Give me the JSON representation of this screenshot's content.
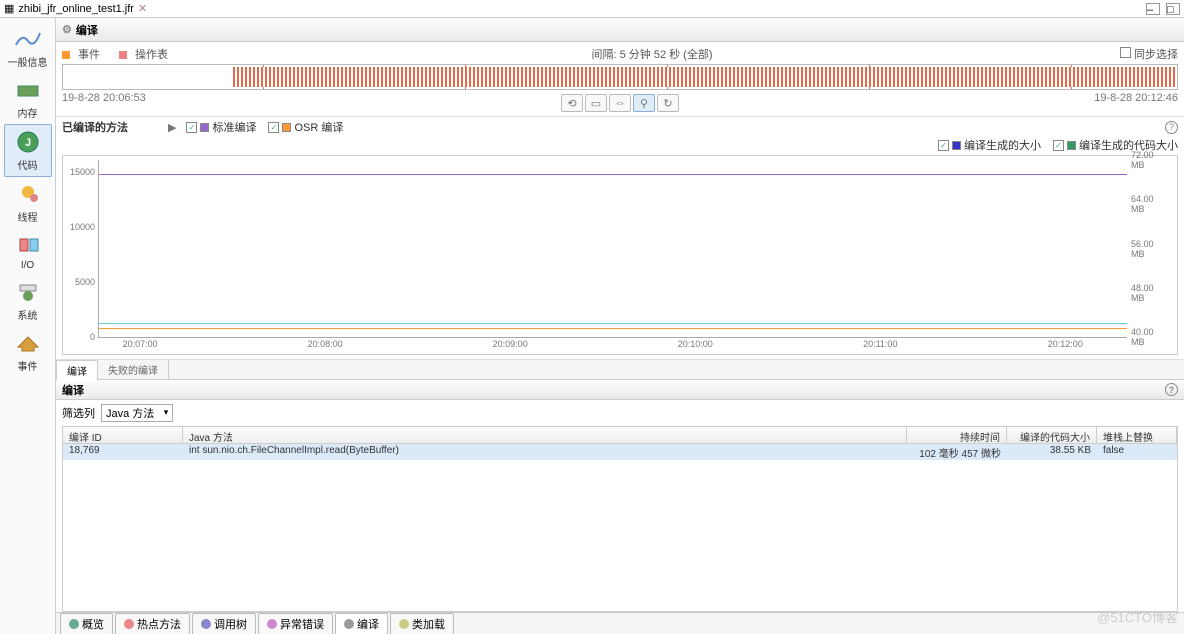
{
  "tab": {
    "title": "zhibi_jfr_online_test1.jfr"
  },
  "page_title": "编译",
  "interval_label": "间隔: 5 分钟 52 秒 (全部)",
  "sync_label": "同步选择",
  "timeline": {
    "event_label": "事件",
    "op_table_label": "操作表",
    "start_time": "19-8-28 20:06:53",
    "end_time": "19-8-28 20:12:46"
  },
  "sidebar": {
    "items": [
      {
        "label": "一般信息"
      },
      {
        "label": "内存"
      },
      {
        "label": "代码"
      },
      {
        "label": "线程"
      },
      {
        "label": "I/O"
      },
      {
        "label": "系统"
      },
      {
        "label": "事件"
      }
    ],
    "active_index": 2
  },
  "chart": {
    "title": "已编译的方法",
    "legends_left": [
      {
        "label": "标准编译",
        "class": "purple"
      },
      {
        "label": "OSR 编译",
        "class": "orange"
      }
    ],
    "legends_right": [
      {
        "label": "编译生成的大小",
        "class": "blue"
      },
      {
        "label": "编译生成的代码大小",
        "class": "green"
      }
    ]
  },
  "chart_data": {
    "type": "line",
    "x": [
      "20:07:00",
      "20:08:00",
      "20:09:00",
      "20:10:00",
      "20:11:00",
      "20:12:00"
    ],
    "y_left_ticks": [
      0,
      5000,
      10000,
      15000
    ],
    "y_right_ticks": [
      "40.00 MB",
      "48.00 MB",
      "56.00 MB",
      "64.00 MB",
      "72.00 MB"
    ],
    "series": [
      {
        "name": "标准编译",
        "color": "#9966cc",
        "approx_value": 14000
      },
      {
        "name": "编译生成的大小",
        "color": "#66cccc",
        "approx_value": 800
      },
      {
        "name": "编译生成的代码大小",
        "color": "#ff9933",
        "approx_value": 300
      }
    ],
    "xlabel": "",
    "ylabel": "",
    "ylim_left": [
      0,
      16000
    ]
  },
  "mid_tabs": {
    "items": [
      "编译",
      "失败的编译"
    ],
    "active": 0
  },
  "sub_title": "编译",
  "filter": {
    "label": "筛选列",
    "value": "Java 方法"
  },
  "table": {
    "columns": [
      "编译 ID",
      "Java 方法",
      "持续时间",
      "编译的代码大小",
      "堆栈上替换"
    ],
    "rows": [
      {
        "id": "18,769",
        "method": "int sun.nio.ch.FileChannelImpl.read(ByteBuffer)",
        "duration": "102 毫秒 457 微秒",
        "size": "38.55 KB",
        "osr": "false"
      }
    ]
  },
  "bottom_tabs": [
    "概览",
    "热点方法",
    "调用树",
    "异常错误",
    "编译",
    "类加载"
  ]
}
